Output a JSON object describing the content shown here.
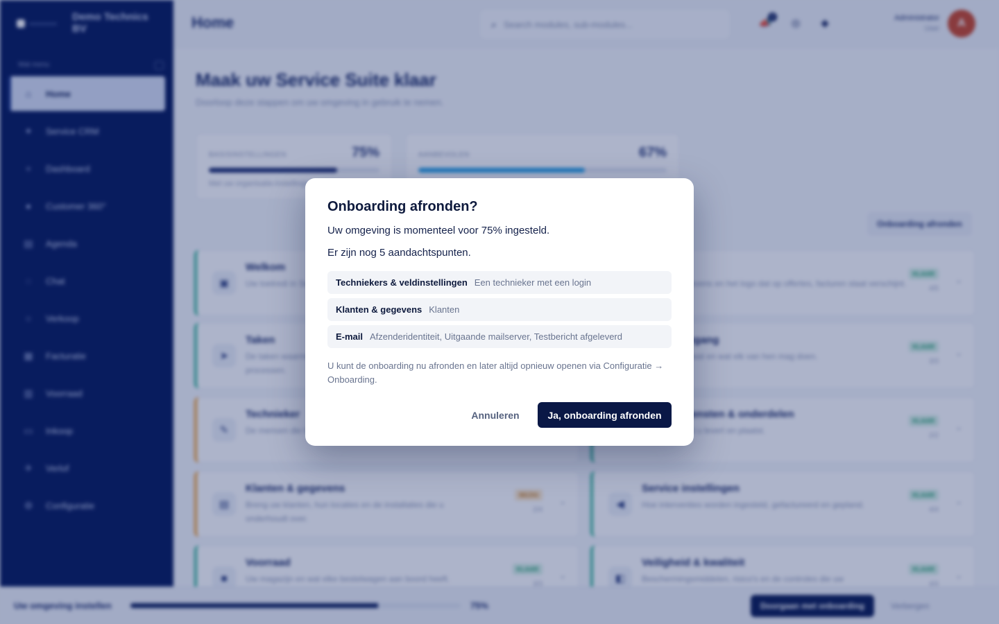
{
  "sidebar": {
    "brand": "Demo Technics BV",
    "menu_title": "Wat menu",
    "items": [
      {
        "label": "Home",
        "icon": "home-icon"
      },
      {
        "label": "Service CRM",
        "icon": "tools-icon"
      },
      {
        "label": "Dashboard",
        "icon": "dashboard-icon"
      },
      {
        "label": "Customer 360°",
        "icon": "customer-icon"
      },
      {
        "label": "Agenda",
        "icon": "calendar-icon"
      },
      {
        "label": "Chat",
        "icon": "chat-icon"
      },
      {
        "label": "Verkoop",
        "icon": "sales-icon"
      },
      {
        "label": "Facturatie",
        "icon": "invoice-icon"
      },
      {
        "label": "Voorraad",
        "icon": "stock-icon"
      },
      {
        "label": "Inkoop",
        "icon": "purchase-icon"
      },
      {
        "label": "Verlof",
        "icon": "leave-icon"
      },
      {
        "label": "Configuratie",
        "icon": "gear-icon"
      }
    ]
  },
  "header": {
    "title": "Home",
    "search_placeholder": "Search modules, sub-modules...",
    "notification_count": "2",
    "user_name": "Administrator",
    "user_role": "User",
    "avatar_initial": "A"
  },
  "main": {
    "title": "Maak uw Service Suite klaar",
    "subtitle": "Doorloop deze stappen om uw omgeving in gebruik te nemen.",
    "progress_cards": [
      {
        "label": "BASISINSTELLINGEN",
        "percent": "75%",
        "value": 0.75,
        "desc": "Met uw organisatie-instellingen"
      },
      {
        "label": "AANBEVOLEN",
        "percent": "67%",
        "value": 0.67
      }
    ],
    "finish_link": "Onboarding afronden",
    "steps": [
      {
        "title": "Welkom",
        "desc": "Uw toetredi in Service Suite werkt en uw omgeving",
        "status": "",
        "count": ""
      },
      {
        "title": "",
        "desc": "gegevens en het logo dat op offertes, facturen staat verschijnt.",
        "status": "KLAAR",
        "count": "4/5"
      },
      {
        "title": "Taken",
        "desc": "De taken waarmee u aan de slag gaat en aangepaste processen.",
        "status": "",
        "count": ""
      },
      {
        "title": "Toegang",
        "desc": "wie wat en wat elk van hen mag doen.",
        "status": "KLAAR",
        "count": "3/3"
      },
      {
        "title": "Technieker",
        "desc": "De mensen die het werk doen en de ronden die zij rijden.",
        "status": "",
        "count": ""
      },
      {
        "title": "diensten & onderdelen",
        "desc": "wat u levert en plaatst.",
        "status": "KLAAR",
        "count": "2/2"
      },
      {
        "title": "Klanten & gegevens",
        "desc": "Breng uw klanten, hun locaties en de installaties die u onderhoudt over.",
        "status": "BEZIG",
        "count": "2/4"
      },
      {
        "title": "Service instellingen",
        "desc": "Hoe interventies worden ingesteld, gefactureerd en gepland.",
        "status": "KLAAR",
        "count": "4/4"
      },
      {
        "title": "Voorraad",
        "desc": "Uw magazijn en wat elke bestelwagen aan boord heeft.",
        "status": "KLAAR",
        "count": "3/3"
      },
      {
        "title": "Veiligheid & kwaliteit",
        "desc": "Beschermingsmiddelen, risico's en de controles die uw",
        "status": "KLAAR",
        "count": "4/4"
      }
    ]
  },
  "footer": {
    "label": "Uw omgeving instellen",
    "percent": "75%",
    "value": 0.75,
    "primary_button": "Doorgaan met onboarding",
    "secondary_link": "Verbergen"
  },
  "modal": {
    "title": "Onboarding afronden?",
    "line1": "Uw omgeving is momenteel voor 75% ingesteld.",
    "line2": "Er zijn nog 5 aandachtspunten.",
    "issues": [
      {
        "name": "Techniekers & veldinstellingen",
        "detail": "Een technieker met een login"
      },
      {
        "name": "Klanten & gegevens",
        "detail": "Klanten"
      },
      {
        "name": "E-mail",
        "detail": "Afzenderidentiteit, Uitgaande mailserver, Testbericht afgeleverd"
      }
    ],
    "note": "U kunt de onboarding nu afronden en later altijd opnieuw openen via Configuratie → Onboarding.",
    "cancel_label": "Annuleren",
    "confirm_label": "Ja, onboarding afronden"
  }
}
